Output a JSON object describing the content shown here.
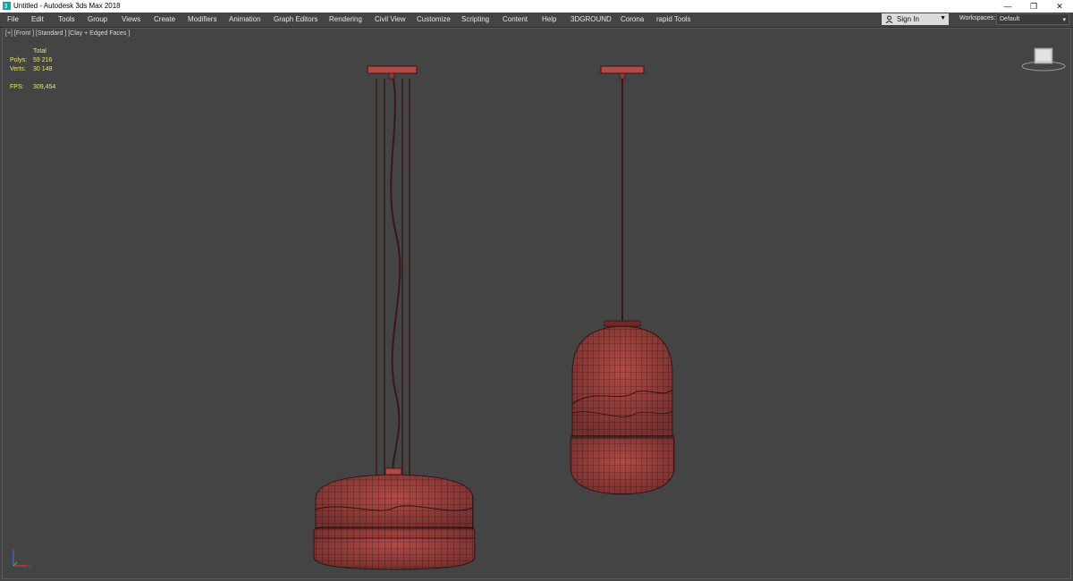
{
  "window": {
    "title": "Untitled - Autodesk 3ds Max 2018",
    "controls": {
      "minimize": "—",
      "restore": "❐",
      "close": "✕"
    }
  },
  "menu": {
    "items": [
      "File",
      "Edit",
      "Tools",
      "Group",
      "Views",
      "Create",
      "Modifiers",
      "Animation",
      "Graph Editors",
      "Rendering",
      "Civil View",
      "Customize",
      "Scripting",
      "Content",
      "Help",
      "3DGROUND",
      "Corona",
      "rapid Tools"
    ]
  },
  "account": {
    "sign_in": "Sign In",
    "icon": "user-icon"
  },
  "workspaces": {
    "label": "Workspaces:",
    "value": "Default"
  },
  "viewport": {
    "label": "[+] [Front ] [Standard ] [Clay + Edged Faces ]",
    "stats": {
      "total_label": "Total",
      "polys_label": "Polys:",
      "polys_value": "59 216",
      "verts_label": "Verts:",
      "verts_value": "30 148",
      "fps_label": "FPS:",
      "fps_value": "309,454"
    }
  },
  "colors": {
    "background": "#444444",
    "lamp_fill": "#b04a46",
    "wire": "#3a1616",
    "stats_text": "#e6e66a"
  }
}
